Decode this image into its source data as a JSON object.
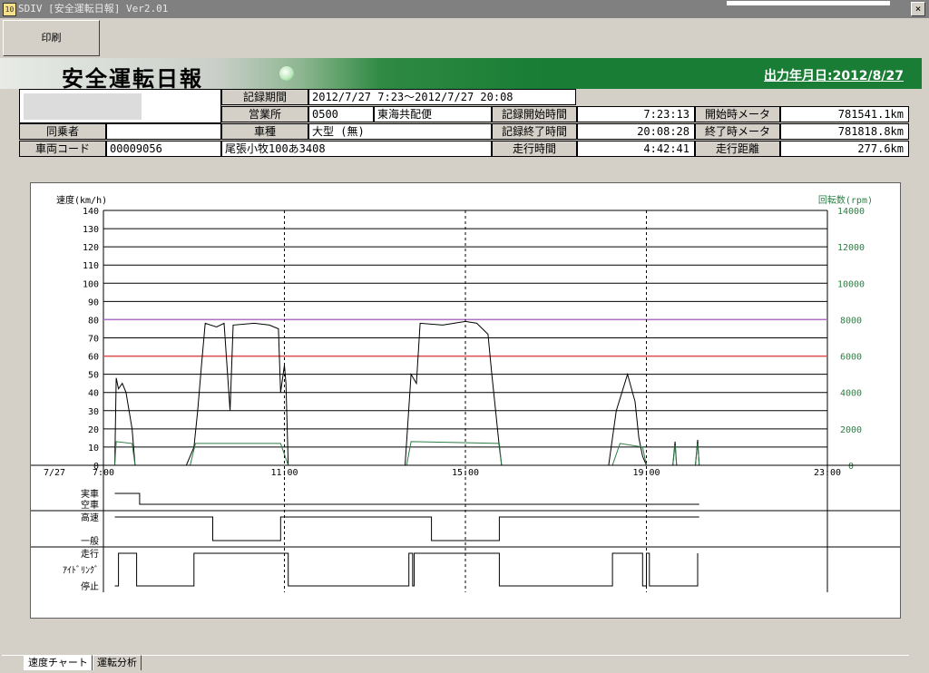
{
  "window": {
    "title": "SDIV [安全運転日報] Ver2.01",
    "icon_label": "10",
    "close_label": "×"
  },
  "toolbar": {
    "print_label": "印刷"
  },
  "report": {
    "title": "安全運転日報",
    "output_date": "出力年月日:2012/8/27"
  },
  "info": {
    "record_period_label": "記録期間",
    "record_period": "2012/7/27 7:23～2012/7/27 20:08",
    "office_label": "営業所",
    "office_code": "0500",
    "office_name": "東海共配便",
    "record_start_label": "記録開始時間",
    "record_start": "7:23:13",
    "meter_start_label": "開始時メータ",
    "meter_start": "781541.1km",
    "companion_label": "同乗者",
    "companion": "",
    "vehicle_type_label": "車種",
    "vehicle_type": "大型 (無)",
    "record_end_label": "記録終了時間",
    "record_end": "20:08:28",
    "meter_end_label": "終了時メータ",
    "meter_end": "781818.8km",
    "vehicle_code_label": "車両コード",
    "vehicle_code": "00009056",
    "plate": "尾張小牧100あ3408",
    "drive_time_label": "走行時間",
    "drive_time": "4:42:41",
    "distance_label": "走行距離",
    "distance": "277.6km"
  },
  "chart_data": {
    "type": "line",
    "xlabel": "7/27",
    "x_ticks": [
      "7:00",
      "11:00",
      "15:00",
      "19:00",
      "23:00"
    ],
    "xlim": [
      "7:00",
      "23:00"
    ],
    "ylabel": "速度(km/h)",
    "ylim": [
      0,
      140
    ],
    "y_ticks": [
      0,
      10,
      20,
      30,
      40,
      50,
      60,
      70,
      80,
      90,
      100,
      110,
      120,
      130,
      140
    ],
    "y2label": "回転数(rpm)",
    "y2lim": [
      0,
      14000
    ],
    "y2_ticks": [
      0,
      2000,
      4000,
      6000,
      8000,
      10000,
      12000,
      14000
    ],
    "reference_lines": [
      {
        "value": 80,
        "color": "#b070c8"
      },
      {
        "value": 60,
        "color": "#e05050"
      }
    ],
    "series": [
      {
        "color": "#000000",
        "axis": "speed",
        "points": [
          [
            "7:15",
            0
          ],
          [
            "7:17",
            48
          ],
          [
            "7:20",
            42
          ],
          [
            "7:25",
            45
          ],
          [
            "7:30",
            40
          ],
          [
            "7:38",
            20
          ],
          [
            "7:42",
            0
          ],
          [
            "8:50",
            0
          ],
          [
            "9:00",
            10
          ],
          [
            "9:05",
            30
          ],
          [
            "9:10",
            55
          ],
          [
            "9:15",
            78
          ],
          [
            "9:30",
            76
          ],
          [
            "9:40",
            78
          ],
          [
            "9:48",
            30
          ],
          [
            "9:52",
            77
          ],
          [
            "10:20",
            78
          ],
          [
            "10:40",
            77
          ],
          [
            "10:52",
            75
          ],
          [
            "10:55",
            40
          ],
          [
            "11:00",
            55
          ],
          [
            "11:02",
            45
          ],
          [
            "11:05",
            0
          ],
          [
            "13:40",
            0
          ],
          [
            "13:48",
            50
          ],
          [
            "13:55",
            45
          ],
          [
            "14:00",
            78
          ],
          [
            "14:30",
            77
          ],
          [
            "14:45",
            78
          ],
          [
            "15:00",
            79
          ],
          [
            "15:15",
            78
          ],
          [
            "15:30",
            72
          ],
          [
            "15:35",
            50
          ],
          [
            "15:40",
            30
          ],
          [
            "15:45",
            10
          ],
          [
            "15:48",
            0
          ],
          [
            "18:10",
            0
          ],
          [
            "18:20",
            30
          ],
          [
            "18:35",
            50
          ],
          [
            "18:45",
            35
          ],
          [
            "18:50",
            15
          ],
          [
            "18:55",
            5
          ],
          [
            "19:00",
            0
          ],
          [
            "19:35",
            0
          ],
          [
            "19:38",
            13
          ],
          [
            "19:40",
            0
          ],
          [
            "20:05",
            0
          ],
          [
            "20:08",
            14
          ],
          [
            "20:10",
            0
          ]
        ]
      },
      {
        "color": "#2e7d46",
        "axis": "rpm",
        "points": [
          [
            "7:15",
            0
          ],
          [
            "7:17",
            1300
          ],
          [
            "7:38",
            1200
          ],
          [
            "7:42",
            0
          ],
          [
            "8:55",
            0
          ],
          [
            "9:02",
            1200
          ],
          [
            "10:55",
            1200
          ],
          [
            "11:05",
            0
          ],
          [
            "13:42",
            0
          ],
          [
            "13:48",
            1300
          ],
          [
            "15:45",
            1200
          ],
          [
            "15:48",
            0
          ],
          [
            "18:15",
            0
          ],
          [
            "18:25",
            1200
          ],
          [
            "18:55",
            1000
          ],
          [
            "19:00",
            0
          ],
          [
            "19:35",
            0
          ],
          [
            "19:38",
            1100
          ],
          [
            "19:40",
            0
          ],
          [
            "20:05",
            0
          ],
          [
            "20:08",
            1200
          ],
          [
            "20:10",
            0
          ]
        ]
      }
    ],
    "status_rows": [
      {
        "labels": [
          "実車",
          "空車"
        ],
        "steps": [
          [
            "7:15",
            0
          ],
          [
            "7:48",
            1
          ],
          [
            "20:10",
            1
          ]
        ]
      },
      {
        "labels": [
          "高速",
          "一般"
        ],
        "steps": [
          [
            "7:15",
            0
          ],
          [
            "9:25",
            1
          ],
          [
            "10:55",
            0
          ],
          [
            "14:15",
            1
          ],
          [
            "15:45",
            0
          ],
          [
            "20:10",
            0
          ]
        ]
      },
      {
        "labels": [
          "走行",
          "ｱｲﾄﾞﾘﾝｸﾞ",
          "停止"
        ],
        "steps": [
          [
            "7:15",
            2
          ],
          [
            "7:20",
            0
          ],
          [
            "7:44",
            2
          ],
          [
            "9:00",
            0
          ],
          [
            "11:05",
            2
          ],
          [
            "13:45",
            0
          ],
          [
            "13:50",
            2
          ],
          [
            "13:52",
            0
          ],
          [
            "15:45",
            2
          ],
          [
            "18:15",
            0
          ],
          [
            "18:55",
            2
          ],
          [
            "19:00",
            0
          ],
          [
            "19:04",
            2
          ],
          [
            "20:08",
            0
          ]
        ]
      }
    ]
  },
  "tabs": [
    {
      "label": "速度チャート",
      "active": true
    },
    {
      "label": "運転分析",
      "active": false
    }
  ]
}
